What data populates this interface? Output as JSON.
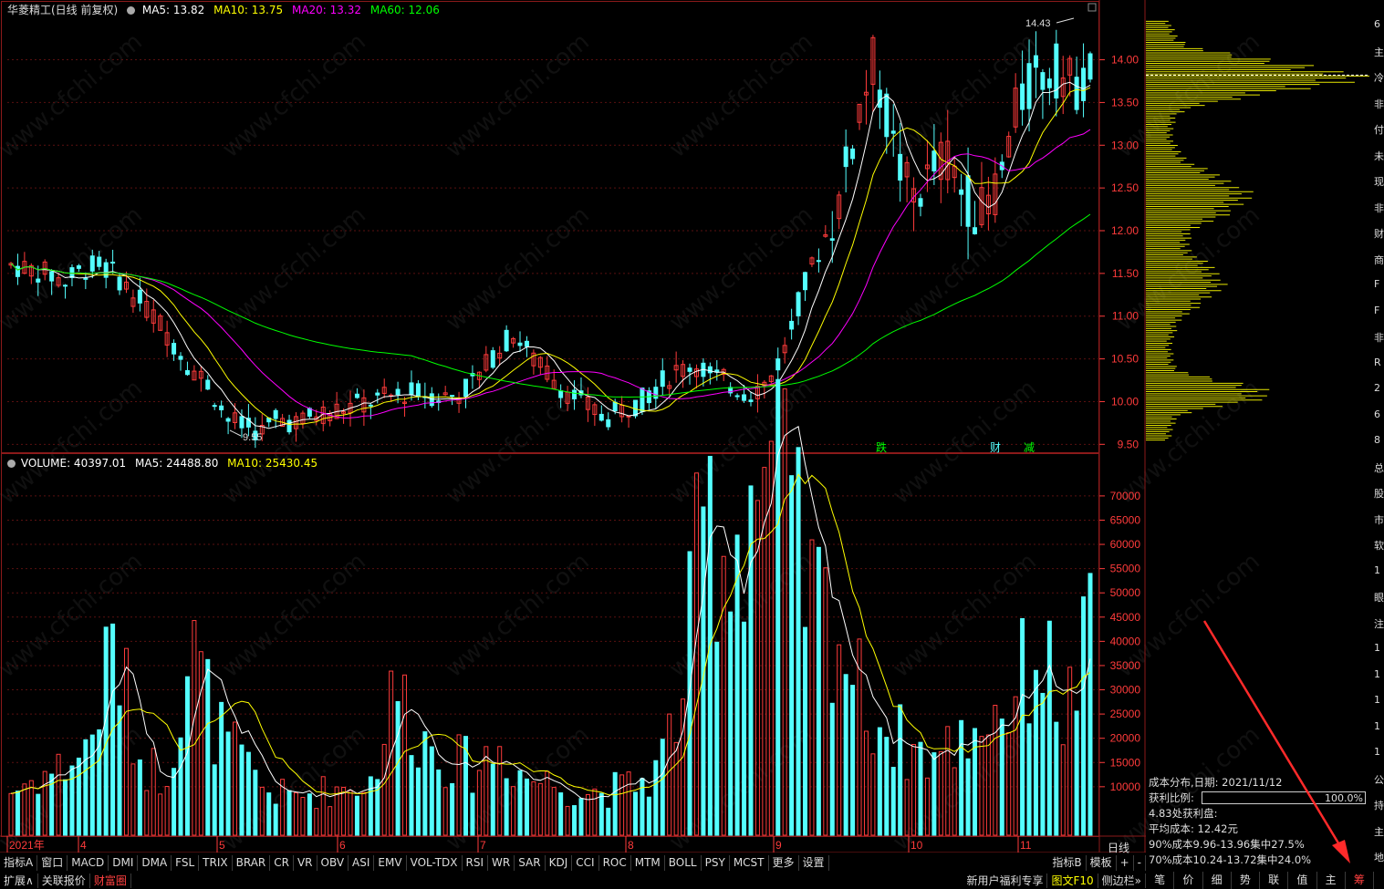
{
  "stock": {
    "title": "华菱精工(日线 前复权)"
  },
  "ma_header": {
    "ma5": "MA5: 13.82",
    "ma10": "MA10: 13.75",
    "ma20": "MA20: 13.32",
    "ma60": "MA60: 12.06"
  },
  "vol_header": {
    "vol": "VOLUME: 40397.01",
    "ma5": "MA5: 24488.80",
    "ma10": "MA10: 25430.45"
  },
  "colors": {
    "up": "#ff3b3b",
    "down": "#54ffff",
    "ma5": "#ffffff",
    "ma10": "#ffff00",
    "ma20": "#ff00ff",
    "ma60": "#00ff00",
    "border": "#8b1a1a",
    "axis": "#ff3b3b"
  },
  "price_axis": {
    "ticks": [
      "14.00",
      "13.50",
      "13.00",
      "12.50",
      "12.00",
      "11.50",
      "11.00",
      "10.50",
      "10.00",
      "9.50"
    ],
    "min": 9.45,
    "max": 14.55
  },
  "vol_axis": {
    "ticks": [
      "70000",
      "65000",
      "60000",
      "55000",
      "50000",
      "45000",
      "40000",
      "35000",
      "30000",
      "25000",
      "20000",
      "15000",
      "10000"
    ],
    "max": 76000
  },
  "time_axis": {
    "labels": [
      "2021年",
      "4",
      "5",
      "6",
      "7",
      "8",
      "9",
      "10",
      "11"
    ],
    "period_label": "日线"
  },
  "annotations": {
    "high": "14.43",
    "low": "9.55",
    "markers": [
      "跌",
      "财",
      "减"
    ]
  },
  "icons": {
    "header_icon": "circle-icon",
    "settings": "gear-icon"
  },
  "chart_data": {
    "type": "candlestick",
    "title": "华菱精工(日线 前复权)",
    "ylim": [
      9.45,
      14.55
    ],
    "x": [
      "2021-03",
      "2021-04",
      "2021-05",
      "2021-06",
      "2021-07",
      "2021-08",
      "2021-09",
      "2021-10",
      "2021-11"
    ],
    "close_trend": [
      11.6,
      11.55,
      11.5,
      11.4,
      11.55,
      11.6,
      11.45,
      11.2,
      11.0,
      10.7,
      10.4,
      10.2,
      9.8,
      9.7,
      9.65,
      9.8,
      9.75,
      9.85,
      9.9,
      9.95,
      10.0,
      10.05,
      10.1,
      10.1,
      10.05,
      10.1,
      10.3,
      10.6,
      10.8,
      10.5,
      10.3,
      10.1,
      9.95,
      9.8,
      9.9,
      10.0,
      10.2,
      10.35,
      10.45,
      10.3,
      10.2,
      10.1,
      10.2,
      10.6,
      11.3,
      11.8,
      12.3,
      13.3,
      14.0,
      13.0,
      12.4,
      12.6,
      12.9,
      12.4,
      12.2,
      12.6,
      13.5,
      13.8,
      13.9,
      13.7,
      13.82
    ],
    "volume_trend": [
      9000,
      12000,
      14000,
      18000,
      40000,
      16000,
      12000,
      39000,
      22000,
      15000,
      9000,
      8000,
      9000,
      10000,
      11000,
      31000,
      20000,
      16000,
      14000,
      18000,
      12000,
      11000,
      9000,
      9000,
      10000,
      12000,
      26000,
      67000,
      58000,
      75000,
      72000,
      50000,
      45000,
      30000,
      22000,
      18000,
      16000,
      20000,
      25000,
      28000,
      40000,
      24000,
      40397
    ],
    "ma5_last": 13.82,
    "ma10_last": 13.75,
    "ma20_last": 13.32,
    "ma60_last": 12.06,
    "high": 14.43,
    "low": 9.55
  },
  "indicator_tabs": [
    "指标A",
    "窗口",
    "MACD",
    "DMI",
    "DMA",
    "FSL",
    "TRIX",
    "BRAR",
    "CR",
    "VR",
    "OBV",
    "ASI",
    "EMV",
    "VOL-TDX",
    "RSI",
    "WR",
    "SAR",
    "KDJ",
    "CCI",
    "ROC",
    "MTM",
    "BOLL",
    "PSY",
    "MCST",
    "更多",
    "设置"
  ],
  "indicator_right": [
    "指标B",
    "模板",
    "+",
    "-"
  ],
  "bottom_tabs": [
    "扩展∧",
    "关联报价",
    "财富圈"
  ],
  "bottom_right": [
    "新用户福利专享",
    "图文F10",
    "侧边栏»"
  ],
  "cost_panel": {
    "date_line": "成本分布,日期:  2021/11/12",
    "profit_label": "获利比例:",
    "profit_value": "100.0%",
    "profit_at": "4.83处获利盘:",
    "avg_cost": "平均成本: 12.42元",
    "c90": "90%成本9.96-13.96集中27.5%",
    "c70": "70%成本10.24-13.72集中24.0%"
  },
  "right_tabs": [
    "笔",
    "价",
    "细",
    "势",
    "联",
    "值",
    "主",
    "筹"
  ],
  "far_right_chars": [
    "6",
    "主",
    "冷",
    "非",
    "付",
    "未",
    "现",
    "非",
    "财",
    "商",
    "F",
    "F",
    "非",
    "R",
    "2",
    "6",
    "8",
    "总",
    "股",
    "市",
    "软",
    "1",
    "眼",
    "注",
    "1",
    "1",
    "1",
    "1",
    "1",
    "公",
    "持",
    "主",
    "地"
  ],
  "watermark": "www.cfchi.com"
}
